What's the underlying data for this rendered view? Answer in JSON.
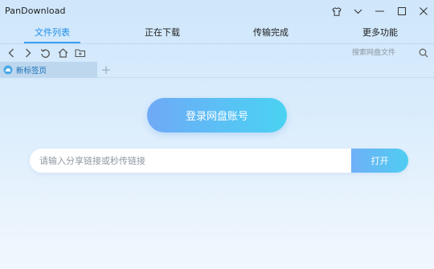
{
  "window": {
    "title": "PanDownload",
    "controls": [
      "shirt-icon",
      "chevron-down-icon",
      "minimize-icon",
      "maximize-icon",
      "close-icon"
    ]
  },
  "tabs": [
    {
      "label": "文件列表",
      "active": true
    },
    {
      "label": "正在下载",
      "active": false
    },
    {
      "label": "传输完成",
      "active": false
    },
    {
      "label": "更多功能",
      "active": false
    }
  ],
  "toolbar": {
    "icons": [
      "back-arrow-icon",
      "forward-arrow-icon",
      "refresh-icon",
      "home-icon",
      "new-folder-icon"
    ],
    "search_placeholder": "搜索网盘文件",
    "search_icon": "search-icon"
  },
  "page_tabs": {
    "items": [
      {
        "label": "新标签页",
        "icon": "cloud-icon"
      }
    ],
    "new_tab_symbol": "+"
  },
  "main": {
    "login_label": "登录网盘账号",
    "link_placeholder": "请输入分享链接或秒传链接",
    "open_label": "打开"
  },
  "colors": {
    "accent": "#1f8fe8",
    "button_gradient_start": "#6fa9f6",
    "button_gradient_end": "#4ad2f1",
    "background_top": "#cfe6fb",
    "background_bottom": "#f1f7fe"
  }
}
